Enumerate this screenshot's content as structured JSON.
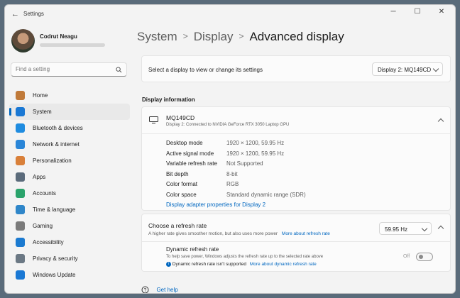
{
  "window": {
    "title": "Settings"
  },
  "user": {
    "name": "Codrut Neagu"
  },
  "search": {
    "placeholder": "Find a setting"
  },
  "nav": [
    {
      "label": "Home",
      "icon": "home-icon",
      "color": "#c07a3a"
    },
    {
      "label": "System",
      "icon": "system-icon",
      "color": "#1a78d4",
      "active": true
    },
    {
      "label": "Bluetooth & devices",
      "icon": "bluetooth-icon",
      "color": "#1f8ce0"
    },
    {
      "label": "Network & internet",
      "icon": "network-icon",
      "color": "#2a86d8"
    },
    {
      "label": "Personalization",
      "icon": "brush-icon",
      "color": "#d9803a"
    },
    {
      "label": "Apps",
      "icon": "apps-icon",
      "color": "#5b6b7b"
    },
    {
      "label": "Accounts",
      "icon": "accounts-icon",
      "color": "#2aa36b"
    },
    {
      "label": "Time & language",
      "icon": "globe-icon",
      "color": "#2f86c9"
    },
    {
      "label": "Gaming",
      "icon": "gaming-icon",
      "color": "#7a7a7a"
    },
    {
      "label": "Accessibility",
      "icon": "accessibility-icon",
      "color": "#1b7ad0"
    },
    {
      "label": "Privacy & security",
      "icon": "shield-icon",
      "color": "#6b7884"
    },
    {
      "label": "Windows Update",
      "icon": "update-icon",
      "color": "#1a78d4"
    }
  ],
  "breadcrumb": {
    "level1": "System",
    "level2": "Display",
    "current": "Advanced display"
  },
  "select_display": {
    "label": "Select a display to view or change its settings",
    "value": "Display 2: MQ149CD"
  },
  "display_info": {
    "section_title": "Display information",
    "name": "MQ149CD",
    "subtitle": "Display 2: Connected to NVIDIA GeForce RTX 3050 Laptop GPU",
    "rows": [
      {
        "label": "Desktop mode",
        "value": "1920 × 1200, 59.95 Hz"
      },
      {
        "label": "Active signal mode",
        "value": "1920 × 1200, 59.95 Hz"
      },
      {
        "label": "Variable refresh rate",
        "value": "Not Supported"
      },
      {
        "label": "Bit depth",
        "value": "8-bit"
      },
      {
        "label": "Color format",
        "value": "RGB"
      },
      {
        "label": "Color space",
        "value": "Standard dynamic range (SDR)"
      }
    ],
    "adapter_link": "Display adapter properties for Display 2"
  },
  "refresh": {
    "title": "Choose a refresh rate",
    "subtitle": "A higher rate gives smoother motion, but also uses more power",
    "link": "More about refresh rate",
    "value": "59.95 Hz"
  },
  "dynamic": {
    "title": "Dynamic refresh rate",
    "desc": "To help save power, Windows adjusts the refresh rate up to the selected rate above",
    "note": "Dynamic refresh rate isn't supported",
    "link": "More about dynamic refresh rate",
    "state": "Off"
  },
  "help": {
    "label": "Get help"
  }
}
